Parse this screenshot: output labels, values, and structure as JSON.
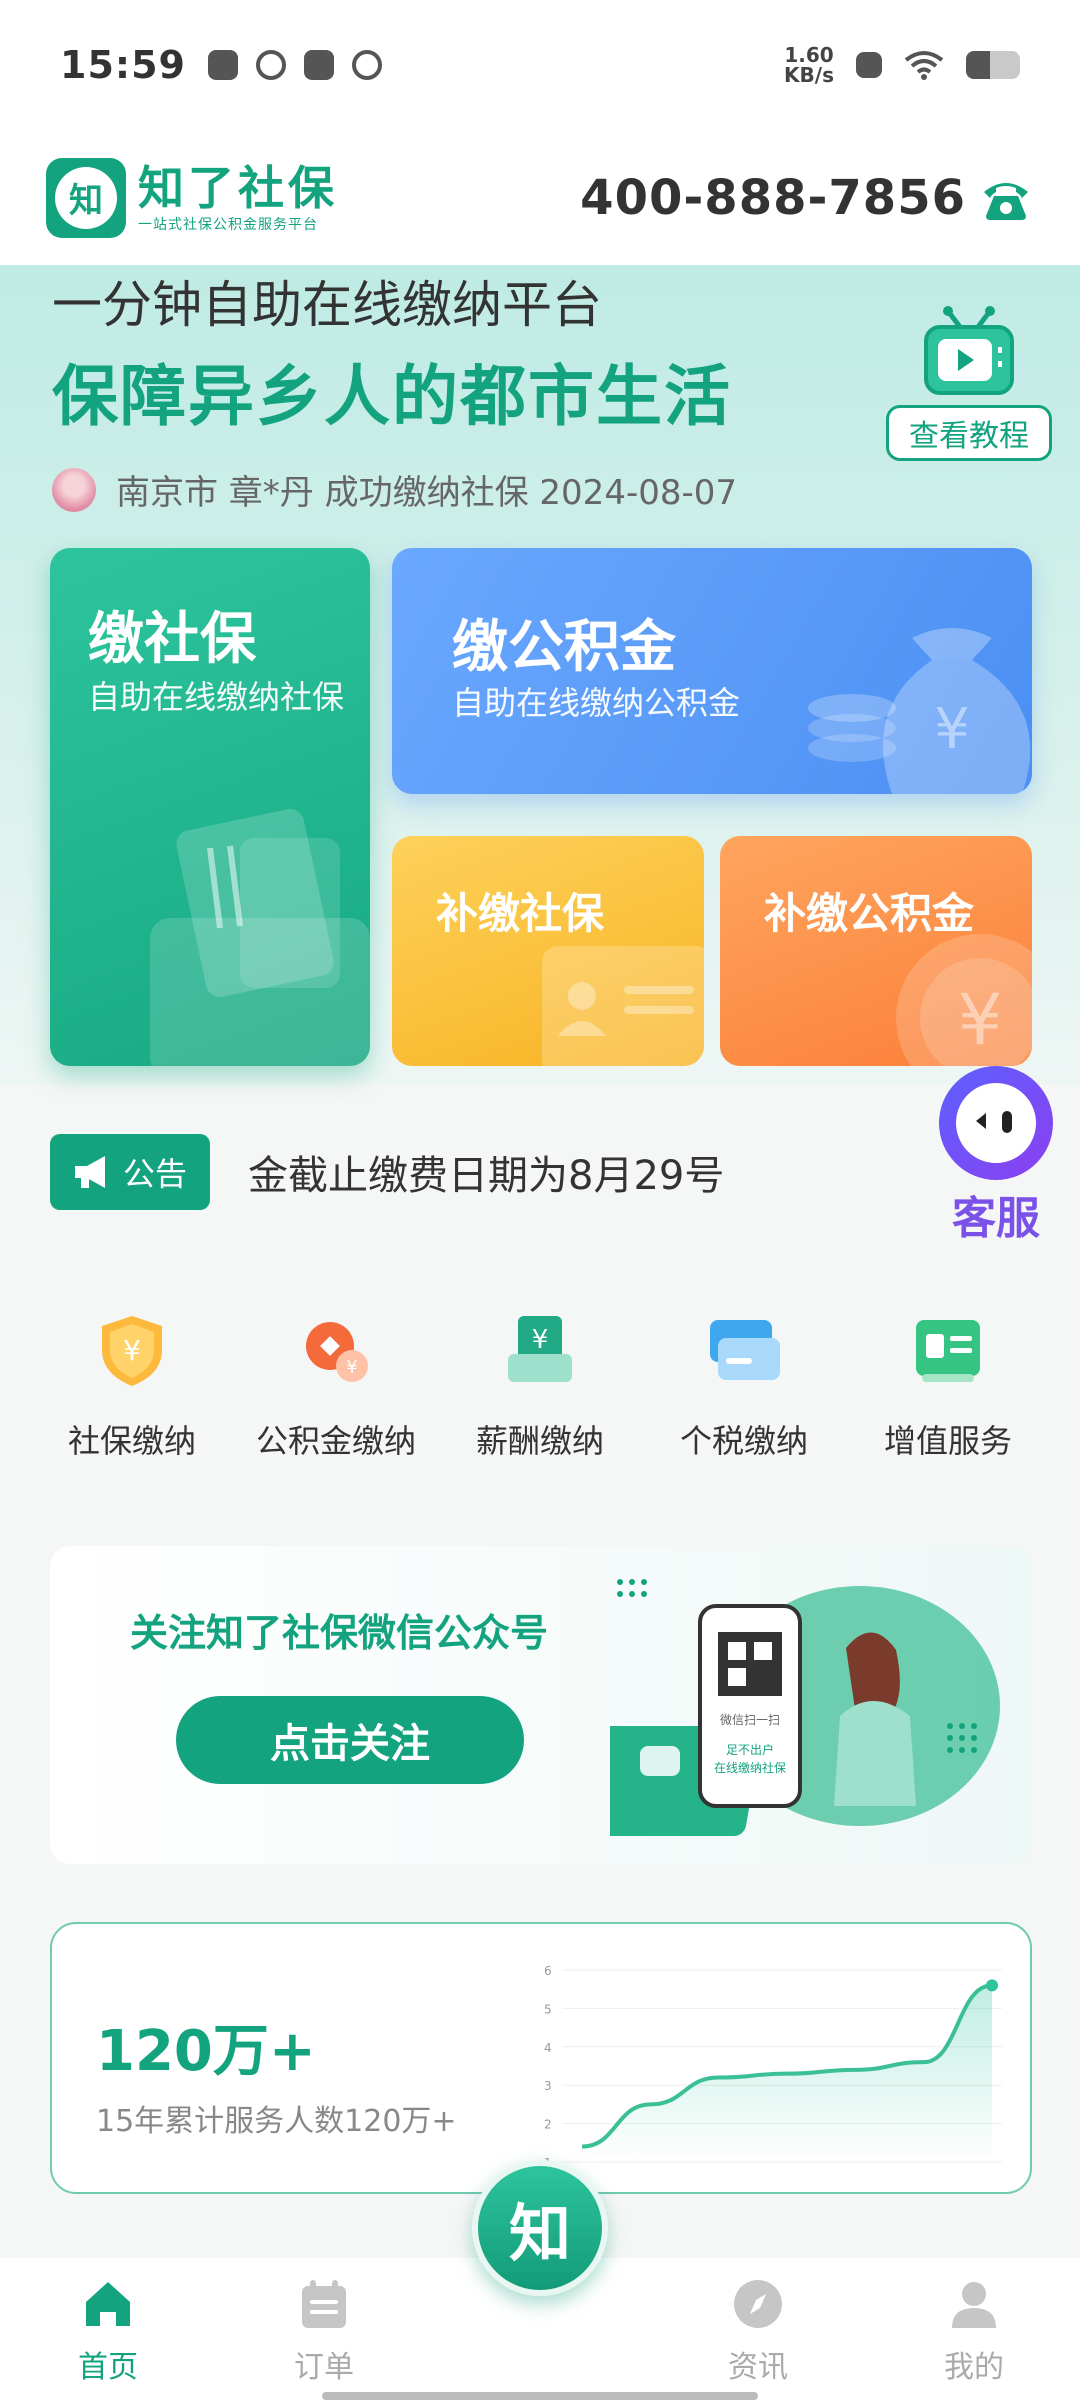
{
  "status_bar": {
    "time": "15:59",
    "net_speed_value": "1.60",
    "net_speed_unit": "KB/s",
    "battery_level": 0.45
  },
  "header": {
    "logo_char": "知",
    "brand": "知了社保",
    "tagline": "一站式社保公积金服务平台",
    "hotline": "400-888-7856"
  },
  "hero": {
    "line1": "一分钟自助在线缴纳平台",
    "line2": "保障异乡人的都市生活",
    "tutorial_label": "查看教程",
    "ticker": "南京市 章*丹 成功缴纳社保 2024-08-07"
  },
  "cards": {
    "social": {
      "title": "缴社保",
      "subtitle": "自助在线缴纳社保"
    },
    "fund": {
      "title": "缴公积金",
      "subtitle": "自助在线缴纳公积金"
    },
    "back_social": {
      "title": "补缴社保"
    },
    "back_fund": {
      "title": "补缴公积金"
    }
  },
  "notice": {
    "badge": "公告",
    "text": "金截止缴费日期为8月29号"
  },
  "customer_service": "客服",
  "quick_menu": [
    {
      "label": "社保缴纳",
      "icon": "shield-yen-icon"
    },
    {
      "label": "公积金缴纳",
      "icon": "coin-icon"
    },
    {
      "label": "薪酬缴纳",
      "icon": "salary-icon"
    },
    {
      "label": "个税缴纳",
      "icon": "card-icon"
    },
    {
      "label": "增值服务",
      "icon": "id-card-icon"
    }
  ],
  "follow_banner": {
    "title": "关注知了社保微信公众号",
    "button": "点击关注",
    "phone_line1": "微信扫一扫",
    "phone_line2": "足不出户",
    "phone_line3": "在线缴纳社保"
  },
  "stats": {
    "value": "120万+",
    "caption": "15年累计服务人数120万+"
  },
  "chart_data": {
    "type": "line",
    "y_ticks": [
      "1",
      "2",
      "3",
      "4",
      "5",
      "6"
    ],
    "ylim": [
      1,
      6
    ],
    "series": [
      {
        "values": [
          1.4,
          2.5,
          3.2,
          3.3,
          3.4,
          3.6,
          5.6
        ]
      }
    ]
  },
  "tabbar": {
    "home": "首页",
    "orders": "订单",
    "center": "知",
    "news": "资讯",
    "mine": "我的"
  },
  "colors": {
    "brand_green": "#13a37f",
    "service_purple": "#7b52e8"
  }
}
